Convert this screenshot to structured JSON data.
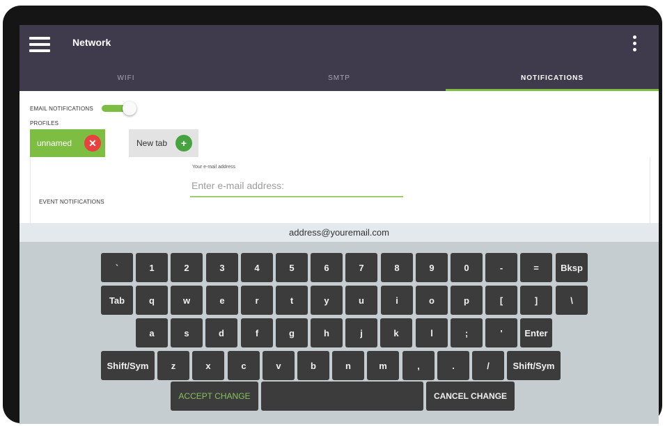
{
  "app": {
    "title": "Network"
  },
  "tabs": [
    {
      "label": "WIFI"
    },
    {
      "label": "SMTP"
    },
    {
      "label": "NOTIFICATIONS",
      "active": true
    }
  ],
  "settings": {
    "email_notifications_label": "EMAIL NOTIFICATIONS",
    "email_notifications_on": true,
    "profiles_label": "PROFILES",
    "profile_tab_label": "unnamed",
    "new_tab_label": "New tab",
    "email_caption": "Your e-mail address",
    "email_placeholder": "Enter e-mail address:",
    "event_notifications_label": "EVENT NOTIFICATIONS"
  },
  "keyboard": {
    "preview_text": "address@youremail.com",
    "rows": [
      [
        "`",
        "1",
        "2",
        "3",
        "4",
        "5",
        "6",
        "7",
        "8",
        "9",
        "0",
        "-",
        "=",
        "Bksp"
      ],
      [
        "Tab",
        "q",
        "w",
        "e",
        "r",
        "t",
        "y",
        "u",
        "i",
        "o",
        "p",
        "[",
        "]",
        "\\"
      ],
      [
        "a",
        "s",
        "d",
        "f",
        "g",
        "h",
        "j",
        "k",
        "l",
        ";",
        "'",
        "Enter"
      ],
      [
        "Shift/Sym",
        "z",
        "x",
        "c",
        "v",
        "b",
        "n",
        "m",
        ",",
        ".",
        "/",
        "Shift/Sym"
      ]
    ],
    "accept_label": "ACCEPT CHANGE",
    "cancel_label": "CANCEL CHANGE"
  },
  "colors": {
    "app_bar": "#3f3a4c",
    "accent_green": "#7cbd42",
    "close_red": "#e8413f",
    "key_dark": "#3c3c3c",
    "keyboard_bg": "#c5cdd1"
  }
}
